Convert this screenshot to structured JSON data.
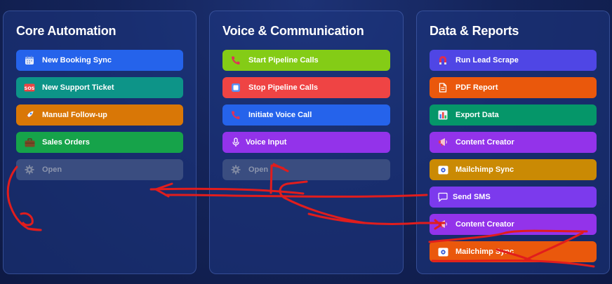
{
  "colors": {
    "blue": "#2563eb",
    "teal": "#0d9488",
    "amber": "#d97706",
    "green": "#16a34a",
    "lime": "#84cc16",
    "red": "#ef4444",
    "indigo": "#4f46e5",
    "orange": "#ea580c",
    "emerald": "#059669",
    "purple": "#9333ea",
    "gold": "#ca8a04",
    "violet": "#7c3aed",
    "annotation": "#e11d1d"
  },
  "panels": [
    {
      "title": "Core Automation",
      "buttons": [
        {
          "label": "New Booking Sync",
          "icon": "calendar-icon"
        },
        {
          "label": "New Support Ticket",
          "icon": "sos-icon"
        },
        {
          "label": "Manual Follow-up",
          "icon": "rocket-icon"
        },
        {
          "label": "Sales Orders",
          "icon": "briefcase-icon"
        },
        {
          "label": "Open",
          "icon": "gear-icon"
        }
      ]
    },
    {
      "title": "Voice & Communication",
      "buttons": [
        {
          "label": "Start Pipeline Calls",
          "icon": "phone-icon"
        },
        {
          "label": "Stop Pipeline Calls",
          "icon": "stop-icon"
        },
        {
          "label": "Initiate Voice Call",
          "icon": "phone-icon"
        },
        {
          "label": "Voice Input",
          "icon": "microphone-icon"
        },
        {
          "label": "Open",
          "icon": "gear-icon"
        }
      ]
    },
    {
      "title": "Data & Reports",
      "buttons": [
        {
          "label": "Run Lead Scrape",
          "icon": "magnet-icon"
        },
        {
          "label": "PDF Report",
          "icon": "document-icon"
        },
        {
          "label": "Export Data",
          "icon": "bar-chart-icon"
        },
        {
          "label": "Content Creator",
          "icon": "megaphone-icon"
        },
        {
          "label": "Mailchimp Sync",
          "icon": "gear-chip-icon"
        },
        {
          "label": "Send SMS",
          "icon": "chat-bubble-icon"
        },
        {
          "label": "Content Creator",
          "icon": "megaphone-icon"
        },
        {
          "label": "Mailchimp Sync",
          "icon": "gear-chip-icon"
        }
      ]
    }
  ]
}
